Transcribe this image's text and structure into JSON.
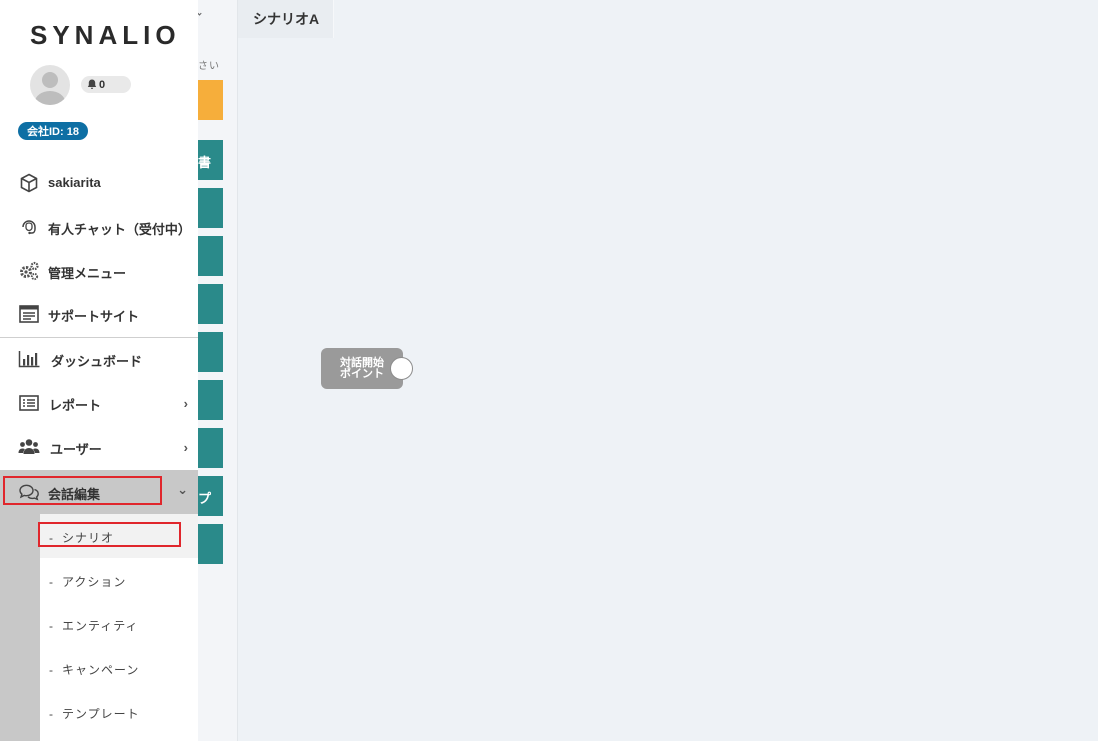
{
  "sidebar": {
    "logo": "SYNALIO",
    "notification_count": "0",
    "company_badge": "会社ID: 18",
    "items": [
      {
        "label": "sakiarita",
        "icon": "box-icon"
      },
      {
        "label": "有人チャット（受付中）",
        "icon": "headset-icon"
      },
      {
        "label": "管理メニュー",
        "icon": "gears-icon"
      },
      {
        "label": "サポートサイト",
        "icon": "browser-window-icon"
      },
      {
        "label": "ダッシュボード",
        "icon": "bar-chart-icon"
      },
      {
        "label": "レポート",
        "icon": "list-icon",
        "chevron": "›"
      },
      {
        "label": "ユーザー",
        "icon": "users-icon",
        "chevron": "›"
      },
      {
        "label": "会話編集",
        "icon": "chat-bubbles-icon",
        "chevron": "⌄",
        "active": true
      }
    ],
    "submenu": [
      {
        "label": "シナリオ",
        "selected": true
      },
      {
        "label": "アクション"
      },
      {
        "label": "エンティティ"
      },
      {
        "label": "キャンペーン"
      },
      {
        "label": "テンプレート"
      }
    ],
    "dash": "-"
  },
  "middle_panel": {
    "hint_text": "さい",
    "teal_label_1": "書",
    "teal_label_2": "プ"
  },
  "canvas": {
    "tab_title": "シナリオA",
    "start_node_line1": "対話開始",
    "start_node_line2": "ポイント"
  },
  "colors": {
    "accent_orange": "#f6ae3b",
    "teal": "#2a8a8a",
    "badge_blue": "#0e6fa4",
    "highlight_red": "#e0262c"
  }
}
